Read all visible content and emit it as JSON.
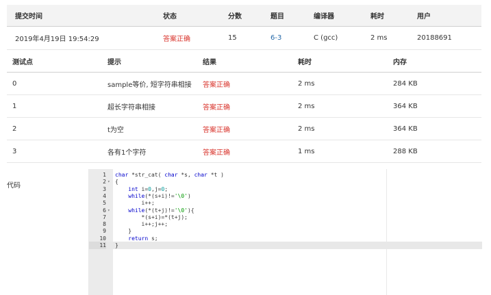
{
  "submission": {
    "headers": {
      "time": "提交时间",
      "status": "状态",
      "score": "分数",
      "problem": "题目",
      "compiler": "编译器",
      "duration": "耗时",
      "user": "用户"
    },
    "row": {
      "time": "2019年4月19日 19:54:29",
      "status": "答案正确",
      "score": "15",
      "problem": "6-3",
      "compiler": "C (gcc)",
      "duration": "2 ms",
      "user": "20188691"
    }
  },
  "cases": {
    "headers": {
      "point": "测试点",
      "hint": "提示",
      "result": "结果",
      "duration": "耗时",
      "memory": "内存"
    },
    "rows": [
      {
        "point": "0",
        "hint": "sample等价, 短字符串相接",
        "result": "答案正确",
        "duration": "2 ms",
        "memory": "284 KB"
      },
      {
        "point": "1",
        "hint": "超长字符串相接",
        "result": "答案正确",
        "duration": "2 ms",
        "memory": "364 KB"
      },
      {
        "point": "2",
        "hint": "t为空",
        "result": "答案正确",
        "duration": "2 ms",
        "memory": "364 KB"
      },
      {
        "point": "3",
        "hint": "各有1个字符",
        "result": "答案正确",
        "duration": "1 ms",
        "memory": "288 KB"
      }
    ]
  },
  "code": {
    "label": "代码",
    "lines": [
      {
        "n": "1",
        "fold": "",
        "text": "char *str_cat( char *s, char *t )"
      },
      {
        "n": "2",
        "fold": "▾",
        "text": "{"
      },
      {
        "n": "3",
        "fold": "",
        "text": "    int i=0,j=0;"
      },
      {
        "n": "4",
        "fold": "",
        "text": "    while(*(s+i)!='\\0')"
      },
      {
        "n": "5",
        "fold": "",
        "text": "        i++;"
      },
      {
        "n": "6",
        "fold": "▾",
        "text": "    while(*(t+j)!='\\0'){"
      },
      {
        "n": "7",
        "fold": "",
        "text": "        *(s+i)=*(t+j);"
      },
      {
        "n": "8",
        "fold": "",
        "text": "        i++;j++;"
      },
      {
        "n": "9",
        "fold": "",
        "text": "    }"
      },
      {
        "n": "10",
        "fold": "",
        "text": "    return s;"
      },
      {
        "n": "11",
        "fold": "",
        "text": "}"
      }
    ],
    "active_line": "11"
  },
  "colors": {
    "accepted": "#d9362e",
    "link": "#2468a8",
    "header_bg": "#f3f3f3",
    "gutter_bg": "#ebebeb"
  }
}
